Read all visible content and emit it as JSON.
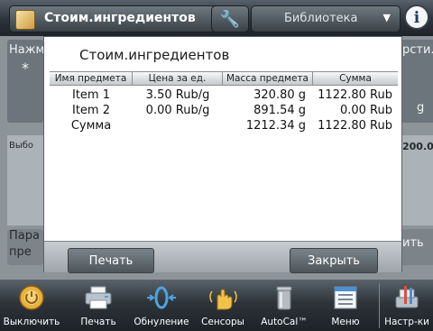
{
  "topbar": {
    "app_label": "Стоим.ингредиентов",
    "library_label": "Библиотека",
    "info_symbol": "i"
  },
  "background": {
    "left_text_1": "Нажм",
    "left_text_2": "*",
    "left_text_3": "Выбо",
    "left_text_4": "Пара",
    "left_text_5": "пре",
    "right_text_1": "рсти.",
    "right_text_2": "g",
    "right_text_3": "200.00",
    "right_text_4": "ить"
  },
  "dialog": {
    "title": "Стоим.ингредиентов",
    "columns": [
      "Имя предмета",
      "Цена за ед.",
      "Масса предмета",
      "Сумма"
    ],
    "rows": [
      [
        "Item 1",
        "3.50 Rub/g",
        "320.80 g",
        "1122.80 Rub"
      ],
      [
        "Item 2",
        "0.00 Rub/g",
        "891.54 g",
        "0.00 Rub"
      ],
      [
        "Сумма",
        "",
        "1212.34 g",
        "1122.80 Rub"
      ]
    ],
    "print_label": "Печать",
    "close_label": "Закрыть"
  },
  "toolbar": {
    "items": [
      {
        "label": "Выключить",
        "icon": "power-icon"
      },
      {
        "label": "Печать",
        "icon": "printer-icon"
      },
      {
        "label": "Обнуление",
        "icon": "zero-icon"
      },
      {
        "label": "Сенсоры",
        "icon": "hand-sensor-icon"
      },
      {
        "label": "AutoCal™",
        "icon": "calibration-weight-icon"
      },
      {
        "label": "Меню",
        "icon": "menu-list-icon"
      },
      {
        "label": "Настр-ки",
        "icon": "settings-icon"
      }
    ]
  },
  "colors": {
    "accent": "#d3882e",
    "toolbar_bg": "#2d343a",
    "dialog_bg": "#ffffff"
  }
}
